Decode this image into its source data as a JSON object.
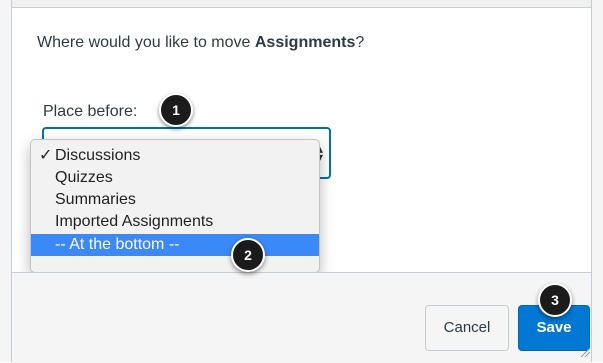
{
  "dialog": {
    "prompt_prefix": "Where would you like to move ",
    "prompt_item": "Assignments",
    "prompt_suffix": "?",
    "field_label": "Place before:",
    "options": [
      {
        "label": "Discussions",
        "checked": true
      },
      {
        "label": "Quizzes",
        "checked": false
      },
      {
        "label": "Summaries",
        "checked": false
      },
      {
        "label": "Imported Assignments",
        "checked": false
      },
      {
        "label": "-- At the bottom --",
        "highlighted": true
      }
    ],
    "check_mark": "✓",
    "cancel_label": "Cancel",
    "save_label": "Save"
  },
  "callouts": {
    "one": "1",
    "two": "2",
    "three": "3"
  },
  "colors": {
    "accent": "#0770a3",
    "highlight": "#3b88f7",
    "save": "#0078d4"
  }
}
